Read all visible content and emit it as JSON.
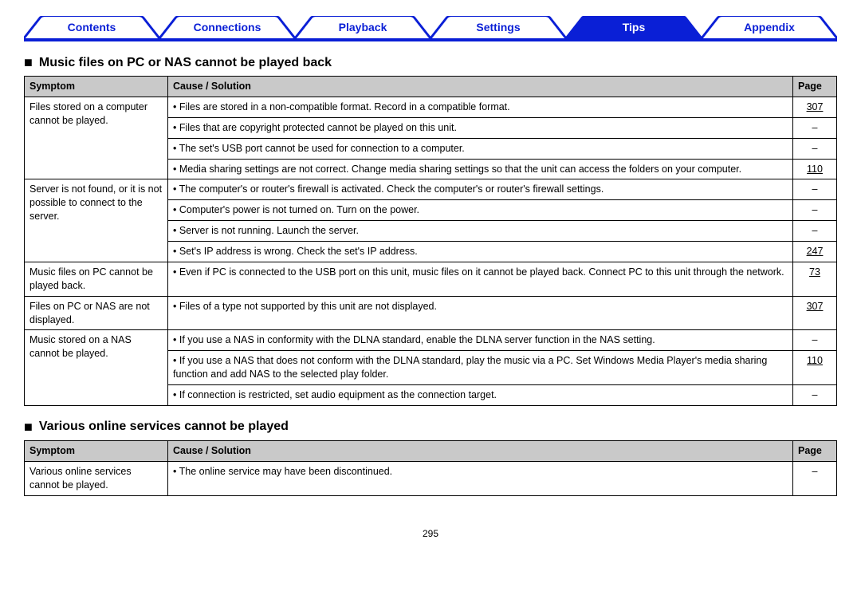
{
  "tabs": [
    {
      "label": "Contents",
      "active": false
    },
    {
      "label": "Connections",
      "active": false
    },
    {
      "label": "Playback",
      "active": false
    },
    {
      "label": "Settings",
      "active": false
    },
    {
      "label": "Tips",
      "active": true
    },
    {
      "label": "Appendix",
      "active": false
    }
  ],
  "sections": [
    {
      "heading": "Music files on PC or NAS cannot be played back",
      "columns": {
        "symptom": "Symptom",
        "cause": "Cause / Solution",
        "page": "Page"
      },
      "groups": [
        {
          "symptom": "Files stored on a computer cannot be played.",
          "rows": [
            {
              "cause": "Files are stored in a non-compatible format. Record in a compatible format.",
              "page": "307"
            },
            {
              "cause": "Files that are copyright protected cannot be played on this unit.",
              "page": "–"
            },
            {
              "cause": "The set's USB port cannot be used for connection to a computer.",
              "page": "–"
            },
            {
              "cause": "Media sharing settings are not correct. Change media sharing settings so that the unit can access the folders on your computer.",
              "page": "110"
            }
          ]
        },
        {
          "symptom": "Server is not found, or it is not possible to connect to the server.",
          "rows": [
            {
              "cause": "The computer's or router's firewall is activated. Check the computer's or router's firewall settings.",
              "page": "–"
            },
            {
              "cause": "Computer's power is not turned on. Turn on the power.",
              "page": "–"
            },
            {
              "cause": "Server is not running. Launch the server.",
              "page": "–"
            },
            {
              "cause": "Set's IP address is wrong. Check the set's IP address.",
              "page": "247"
            }
          ]
        },
        {
          "symptom": "Music files on PC cannot be played back.",
          "rows": [
            {
              "cause": "Even if PC is connected to the USB port on this unit, music files on it cannot be played back. Connect PC to this unit through the network.",
              "page": "73"
            }
          ]
        },
        {
          "symptom": "Files on PC or NAS are not displayed.",
          "rows": [
            {
              "cause": "Files of a type not supported by this unit are not displayed.",
              "page": "307"
            }
          ]
        },
        {
          "symptom": "Music stored on a NAS cannot be played.",
          "rows": [
            {
              "cause": "If you use a NAS in conformity with the DLNA standard, enable the DLNA server function in the NAS setting.",
              "page": "–"
            },
            {
              "cause": "If you use a NAS that does not conform with the DLNA standard, play the music via a PC. Set Windows Media Player's media sharing function and add NAS to the selected play folder.",
              "page": "110"
            },
            {
              "cause": "If connection is restricted, set audio equipment as the connection target.",
              "page": "–"
            }
          ]
        }
      ]
    },
    {
      "heading": "Various online services cannot be played",
      "columns": {
        "symptom": "Symptom",
        "cause": "Cause / Solution",
        "page": "Page"
      },
      "groups": [
        {
          "symptom": "Various online services cannot be played.",
          "rows": [
            {
              "cause": "The online service may have been discontinued.",
              "page": "–"
            }
          ]
        }
      ]
    }
  ],
  "page_number": "295"
}
